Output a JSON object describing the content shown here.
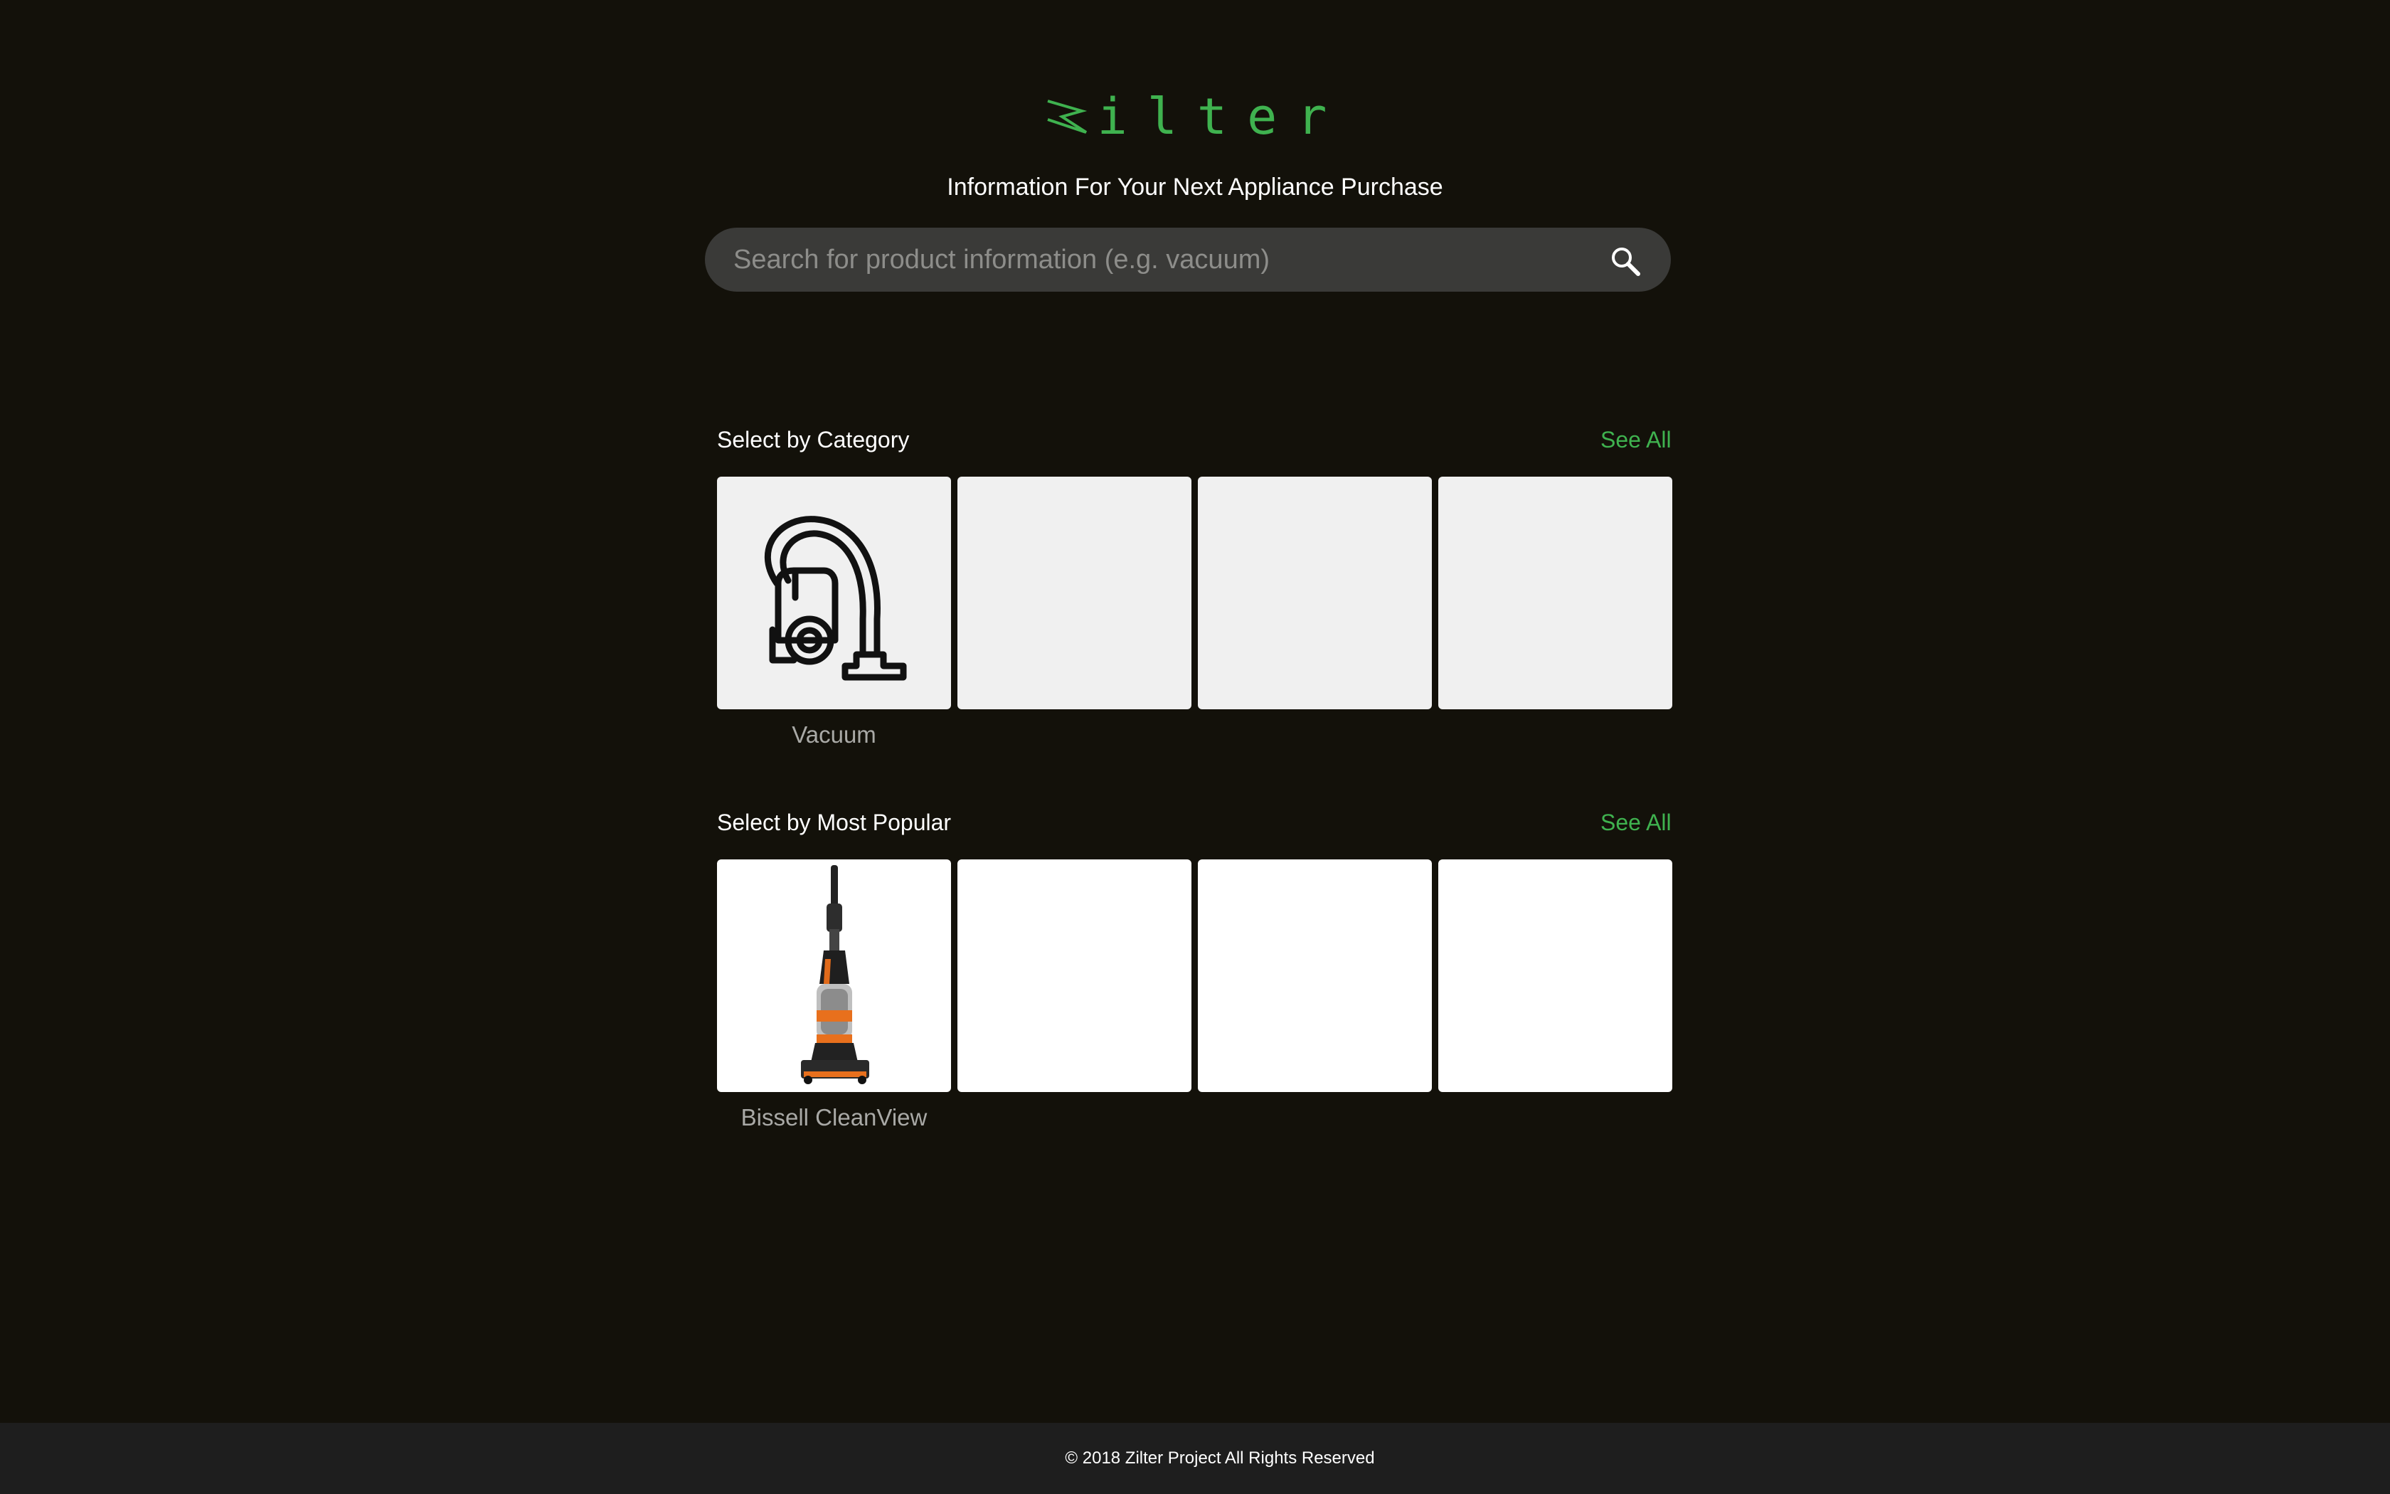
{
  "brand": {
    "logo_text": "ilter",
    "logo_color": "#3fb24f",
    "tagline": "Information For Your Next Appliance Purchase"
  },
  "search": {
    "placeholder": "Search for product information (e.g. vacuum)",
    "value": "",
    "icon": "search-icon"
  },
  "category_section": {
    "title": "Select by Category",
    "see_all": "See All",
    "items": [
      {
        "label": "Vacuum",
        "icon": "vacuum-icon"
      },
      {
        "label": ""
      },
      {
        "label": ""
      },
      {
        "label": ""
      }
    ]
  },
  "popular_section": {
    "title": "Select by Most Popular",
    "see_all": "See All",
    "items": [
      {
        "label": "Bissell CleanView",
        "image": "upright-vacuum-image"
      },
      {
        "label": ""
      },
      {
        "label": ""
      },
      {
        "label": ""
      }
    ]
  },
  "footer": {
    "text": "© 2018 Zilter Project All Rights Reserved"
  },
  "colors": {
    "background": "#13110a",
    "accent": "#3fb24f",
    "search_bg": "#3a3a38",
    "footer_bg": "#1e1e1e"
  }
}
